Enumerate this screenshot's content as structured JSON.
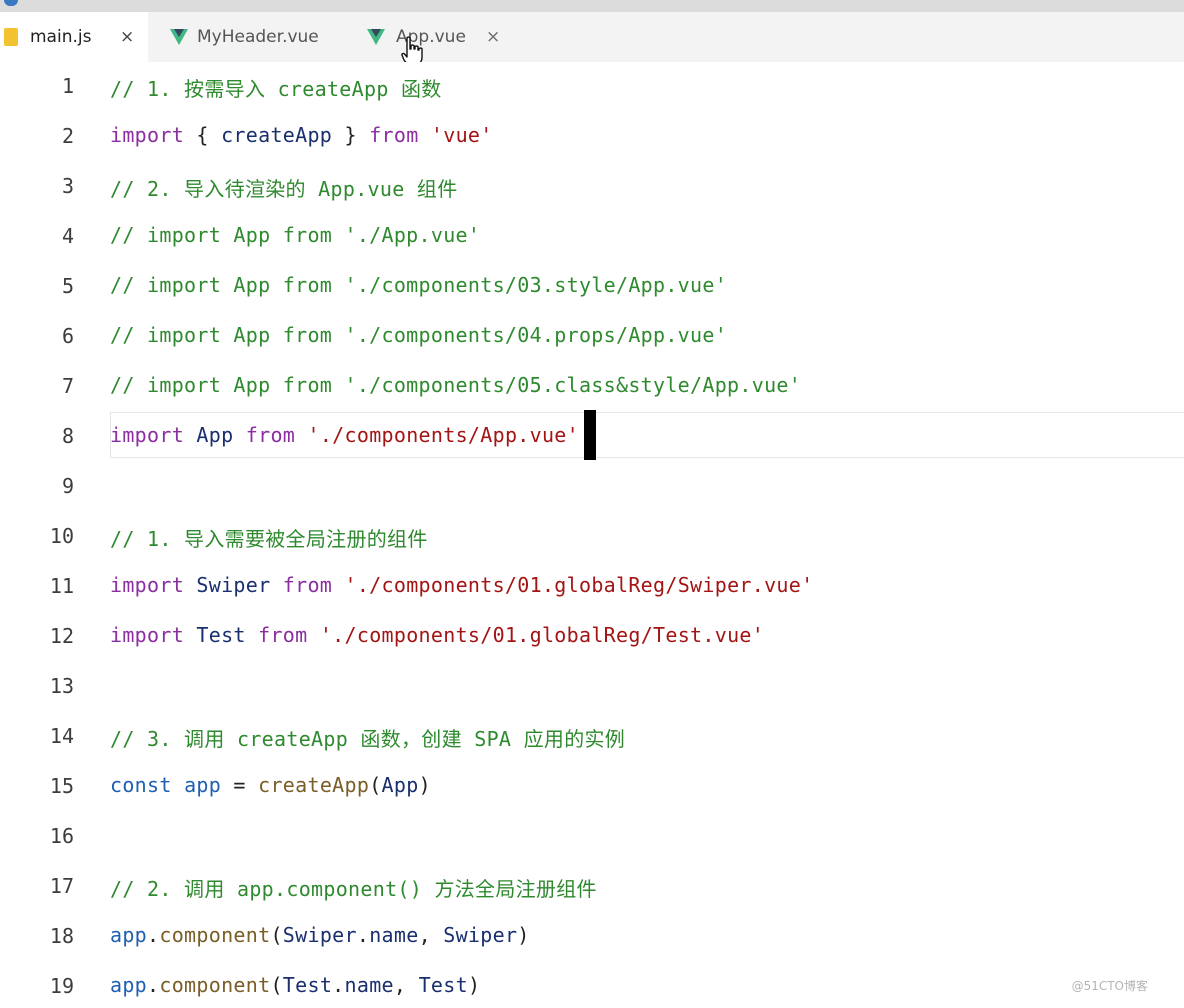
{
  "tabs": [
    {
      "label": "main.js",
      "icon": "js-file-icon",
      "active": true
    },
    {
      "label": "MyHeader.vue",
      "icon": "vue-file-icon",
      "active": false
    },
    {
      "label": "App.vue",
      "icon": "vue-file-icon",
      "active": false
    }
  ],
  "close_glyph": "×",
  "colors": {
    "comment": "#2f8a2f",
    "keyword": "#8b2ea0",
    "string": "#a31515",
    "function": "#795e26",
    "variable": "#1f5fb0",
    "identifier": "#1a2f6e",
    "vue_icon": "#41b883",
    "js_icon": "#f2c230"
  },
  "current_line": 8,
  "lines": [
    {
      "n": "1",
      "tokens": [
        {
          "t": "comment",
          "v": "// 1. 按需导入 createApp 函数"
        }
      ]
    },
    {
      "n": "2",
      "tokens": [
        {
          "t": "keyword",
          "v": "import"
        },
        {
          "t": "plain",
          "v": " { "
        },
        {
          "t": "id",
          "v": "createApp"
        },
        {
          "t": "plain",
          "v": " } "
        },
        {
          "t": "keyword",
          "v": "from"
        },
        {
          "t": "plain",
          "v": " "
        },
        {
          "t": "string",
          "v": "'vue'"
        }
      ]
    },
    {
      "n": "3",
      "tokens": [
        {
          "t": "comment",
          "v": "// 2. 导入待渲染的 App.vue 组件"
        }
      ]
    },
    {
      "n": "4",
      "tokens": [
        {
          "t": "comment",
          "v": "// import App from './App.vue'"
        }
      ]
    },
    {
      "n": "5",
      "tokens": [
        {
          "t": "comment",
          "v": "// import App from './components/03.style/App.vue'"
        }
      ]
    },
    {
      "n": "6",
      "tokens": [
        {
          "t": "comment",
          "v": "// import App from './components/04.props/App.vue'"
        }
      ]
    },
    {
      "n": "7",
      "tokens": [
        {
          "t": "comment",
          "v": "// import App from './components/05.class&style/App.vue'"
        }
      ]
    },
    {
      "n": "8",
      "tokens": [
        {
          "t": "keyword",
          "v": "import"
        },
        {
          "t": "plain",
          "v": " "
        },
        {
          "t": "id",
          "v": "App"
        },
        {
          "t": "plain",
          "v": " "
        },
        {
          "t": "keyword",
          "v": "from"
        },
        {
          "t": "plain",
          "v": " "
        },
        {
          "t": "string",
          "v": "'./components/App.vue'"
        }
      ]
    },
    {
      "n": "9",
      "tokens": []
    },
    {
      "n": "10",
      "tokens": [
        {
          "t": "comment",
          "v": "// 1. 导入需要被全局注册的组件"
        }
      ]
    },
    {
      "n": "11",
      "tokens": [
        {
          "t": "keyword",
          "v": "import"
        },
        {
          "t": "plain",
          "v": " "
        },
        {
          "t": "id",
          "v": "Swiper"
        },
        {
          "t": "plain",
          "v": " "
        },
        {
          "t": "keyword",
          "v": "from"
        },
        {
          "t": "plain",
          "v": " "
        },
        {
          "t": "string",
          "v": "'./components/01.globalReg/Swiper.vue'"
        }
      ]
    },
    {
      "n": "12",
      "tokens": [
        {
          "t": "keyword",
          "v": "import"
        },
        {
          "t": "plain",
          "v": " "
        },
        {
          "t": "id",
          "v": "Test"
        },
        {
          "t": "plain",
          "v": " "
        },
        {
          "t": "keyword",
          "v": "from"
        },
        {
          "t": "plain",
          "v": " "
        },
        {
          "t": "string",
          "v": "'./components/01.globalReg/Test.vue'"
        }
      ]
    },
    {
      "n": "13",
      "tokens": []
    },
    {
      "n": "14",
      "tokens": [
        {
          "t": "comment",
          "v": "// 3. 调用 createApp 函数，创建 SPA 应用的实例"
        }
      ]
    },
    {
      "n": "15",
      "tokens": [
        {
          "t": "var",
          "v": "const"
        },
        {
          "t": "plain",
          "v": " "
        },
        {
          "t": "var",
          "v": "app"
        },
        {
          "t": "plain",
          "v": " = "
        },
        {
          "t": "func",
          "v": "createApp"
        },
        {
          "t": "plain",
          "v": "("
        },
        {
          "t": "id",
          "v": "App"
        },
        {
          "t": "plain",
          "v": ")"
        }
      ]
    },
    {
      "n": "16",
      "tokens": []
    },
    {
      "n": "17",
      "tokens": [
        {
          "t": "comment",
          "v": "// 2. 调用 app.component() 方法全局注册组件"
        }
      ]
    },
    {
      "n": "18",
      "tokens": [
        {
          "t": "var",
          "v": "app"
        },
        {
          "t": "plain",
          "v": "."
        },
        {
          "t": "func",
          "v": "component"
        },
        {
          "t": "plain",
          "v": "("
        },
        {
          "t": "id",
          "v": "Swiper"
        },
        {
          "t": "plain",
          "v": "."
        },
        {
          "t": "id",
          "v": "name"
        },
        {
          "t": "plain",
          "v": ", "
        },
        {
          "t": "id",
          "v": "Swiper"
        },
        {
          "t": "plain",
          "v": ")"
        }
      ]
    },
    {
      "n": "19",
      "tokens": [
        {
          "t": "var",
          "v": "app"
        },
        {
          "t": "plain",
          "v": "."
        },
        {
          "t": "func",
          "v": "component"
        },
        {
          "t": "plain",
          "v": "("
        },
        {
          "t": "id",
          "v": "Test"
        },
        {
          "t": "plain",
          "v": "."
        },
        {
          "t": "id",
          "v": "name"
        },
        {
          "t": "plain",
          "v": ", "
        },
        {
          "t": "id",
          "v": "Test"
        },
        {
          "t": "plain",
          "v": ")"
        }
      ]
    }
  ],
  "watermark": "@51CTO博客"
}
